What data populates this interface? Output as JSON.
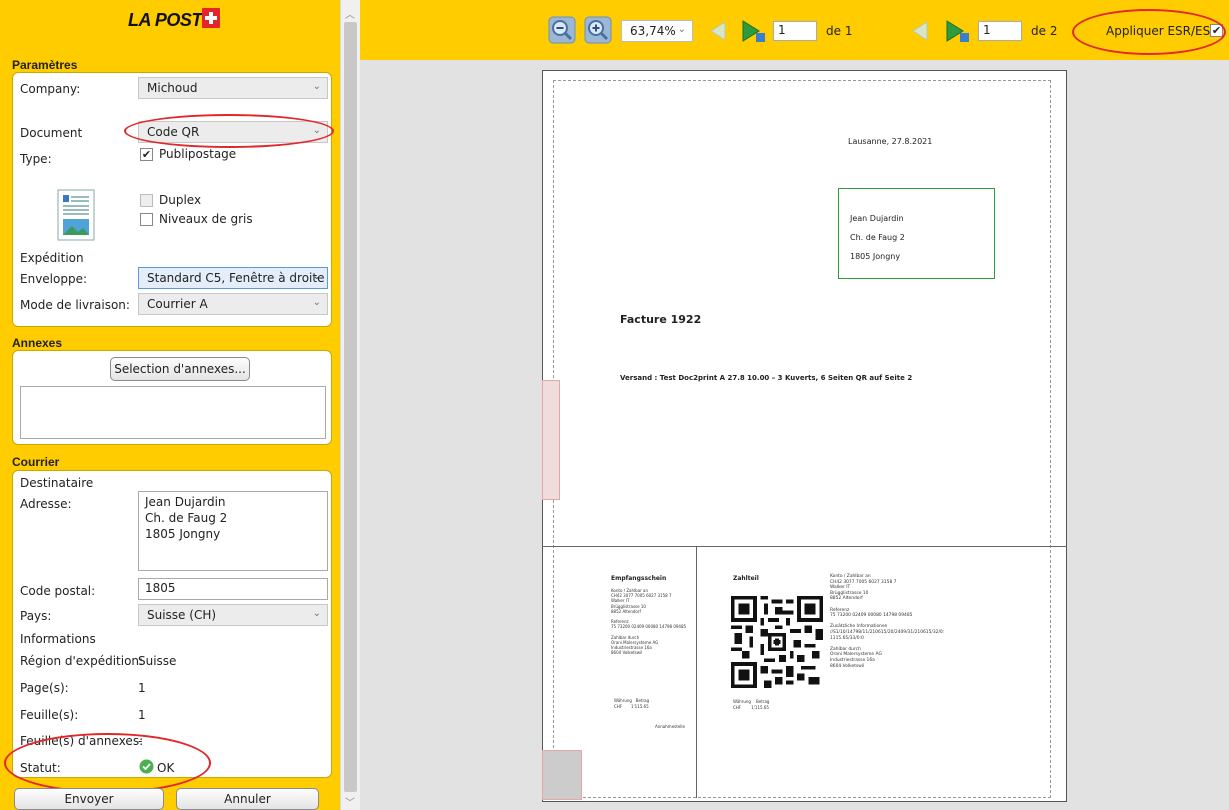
{
  "brand": {
    "logo_text": "LA POSTE",
    "accent": "#ffcc00",
    "red": "#e3262b"
  },
  "parametres": {
    "title": "Paramètres",
    "company_label": "Company:",
    "company_value": "Michoud",
    "document_label": "Document",
    "document_value": "Code QR",
    "type_label": "Type:",
    "publipostage_label": "Publipostage",
    "publipostage_checked": true,
    "duplex_label": "Duplex",
    "duplex_checked": false,
    "gris_label": "Niveaux de gris",
    "gris_checked": false,
    "expedition_label": "Expédition",
    "enveloppe_label": "Enveloppe:",
    "enveloppe_value": "Standard C5, Fenêtre à droite",
    "mode_label": "Mode de livraison:",
    "mode_value": "Courrier A"
  },
  "annexes": {
    "title": "Annexes",
    "button_label": "Selection d'annexes..."
  },
  "courrier": {
    "title": "Courrier",
    "destinataire_label": "Destinataire",
    "adresse_label": "Adresse:",
    "adresse_value": "Jean Dujardin\nCh. de Faug 2\n1805 Jongny",
    "code_postal_label": "Code postal:",
    "code_postal_value": "1805",
    "pays_label": "Pays:",
    "pays_value": "Suisse (CH)",
    "informations_label": "Informations",
    "region_label": "Région d'expédition:",
    "region_value": "Suisse",
    "pages_label": "Page(s):",
    "pages_value": "1",
    "feuilles_label": "Feuille(s):",
    "feuilles_value": "1",
    "feuilles_annexes_label": "Feuille(s) d'annexes:",
    "feuilles_annexes_value": "-",
    "statut_label": "Statut:",
    "statut_value": "OK"
  },
  "actions": {
    "envoyer": "Envoyer",
    "annuler": "Annuler"
  },
  "toolbar": {
    "zoom": "63,74%",
    "page1_value": "1",
    "page1_total": "de 1",
    "page2_value": "1",
    "page2_total": "de 2",
    "apply_label": "Appliquer ESR/ES",
    "apply_checked": true
  },
  "document": {
    "date_line": "Lausanne, 27.8.2021",
    "address_lines": [
      "Jean Dujardin",
      "Ch. de Faug 2",
      "1805 Jongny"
    ],
    "invoice_title": "Facture 1922",
    "versand_line": "Versand : Test Doc2print A 27.8 10.00 – 3 Kuverts, 6 Seiten QR auf Seite 2",
    "qr_slip": {
      "receipt_title": "Empfangsschein",
      "receipt_body": "Konto / Zahlbar an\nCH42 3077 7005 6027 3158 7\nWalker IT\nBrügglistrasse 10\n8852 Altendorf\n\nReferenz\n75 73200 02409 00080 14798 09485\n\nZahlbar durch\nOrani Malersysteme AG\nIndustriestrasse 16a\n8604 Volketswil",
      "receipt_currency": "Währung   Betrag\nCHF       1'115.65",
      "receipt_annahme": "Annahmestelle",
      "payment_title": "Zahlteil",
      "payment_currency": "Währung    Betrag\nCHF        1'115.65",
      "right_body": "Konto / Zahlbar an\nCH42 3077 7005 6027 3158 7\nWalker IT\nBrügglistrasse 10\n8852 Altendorf\n\nReferenz\n75 73200 02409 00080 14798 09485\n\nZusätzliche Informationen\n//S1/10/14798/11/210615/20/2409/31/210615/32/0:\n1115.65/33/0:0\n\nZahlbar durch\nOrani Malersysteme AG\nIndustriestrasse 16a\n8604 Volketswil"
    }
  }
}
